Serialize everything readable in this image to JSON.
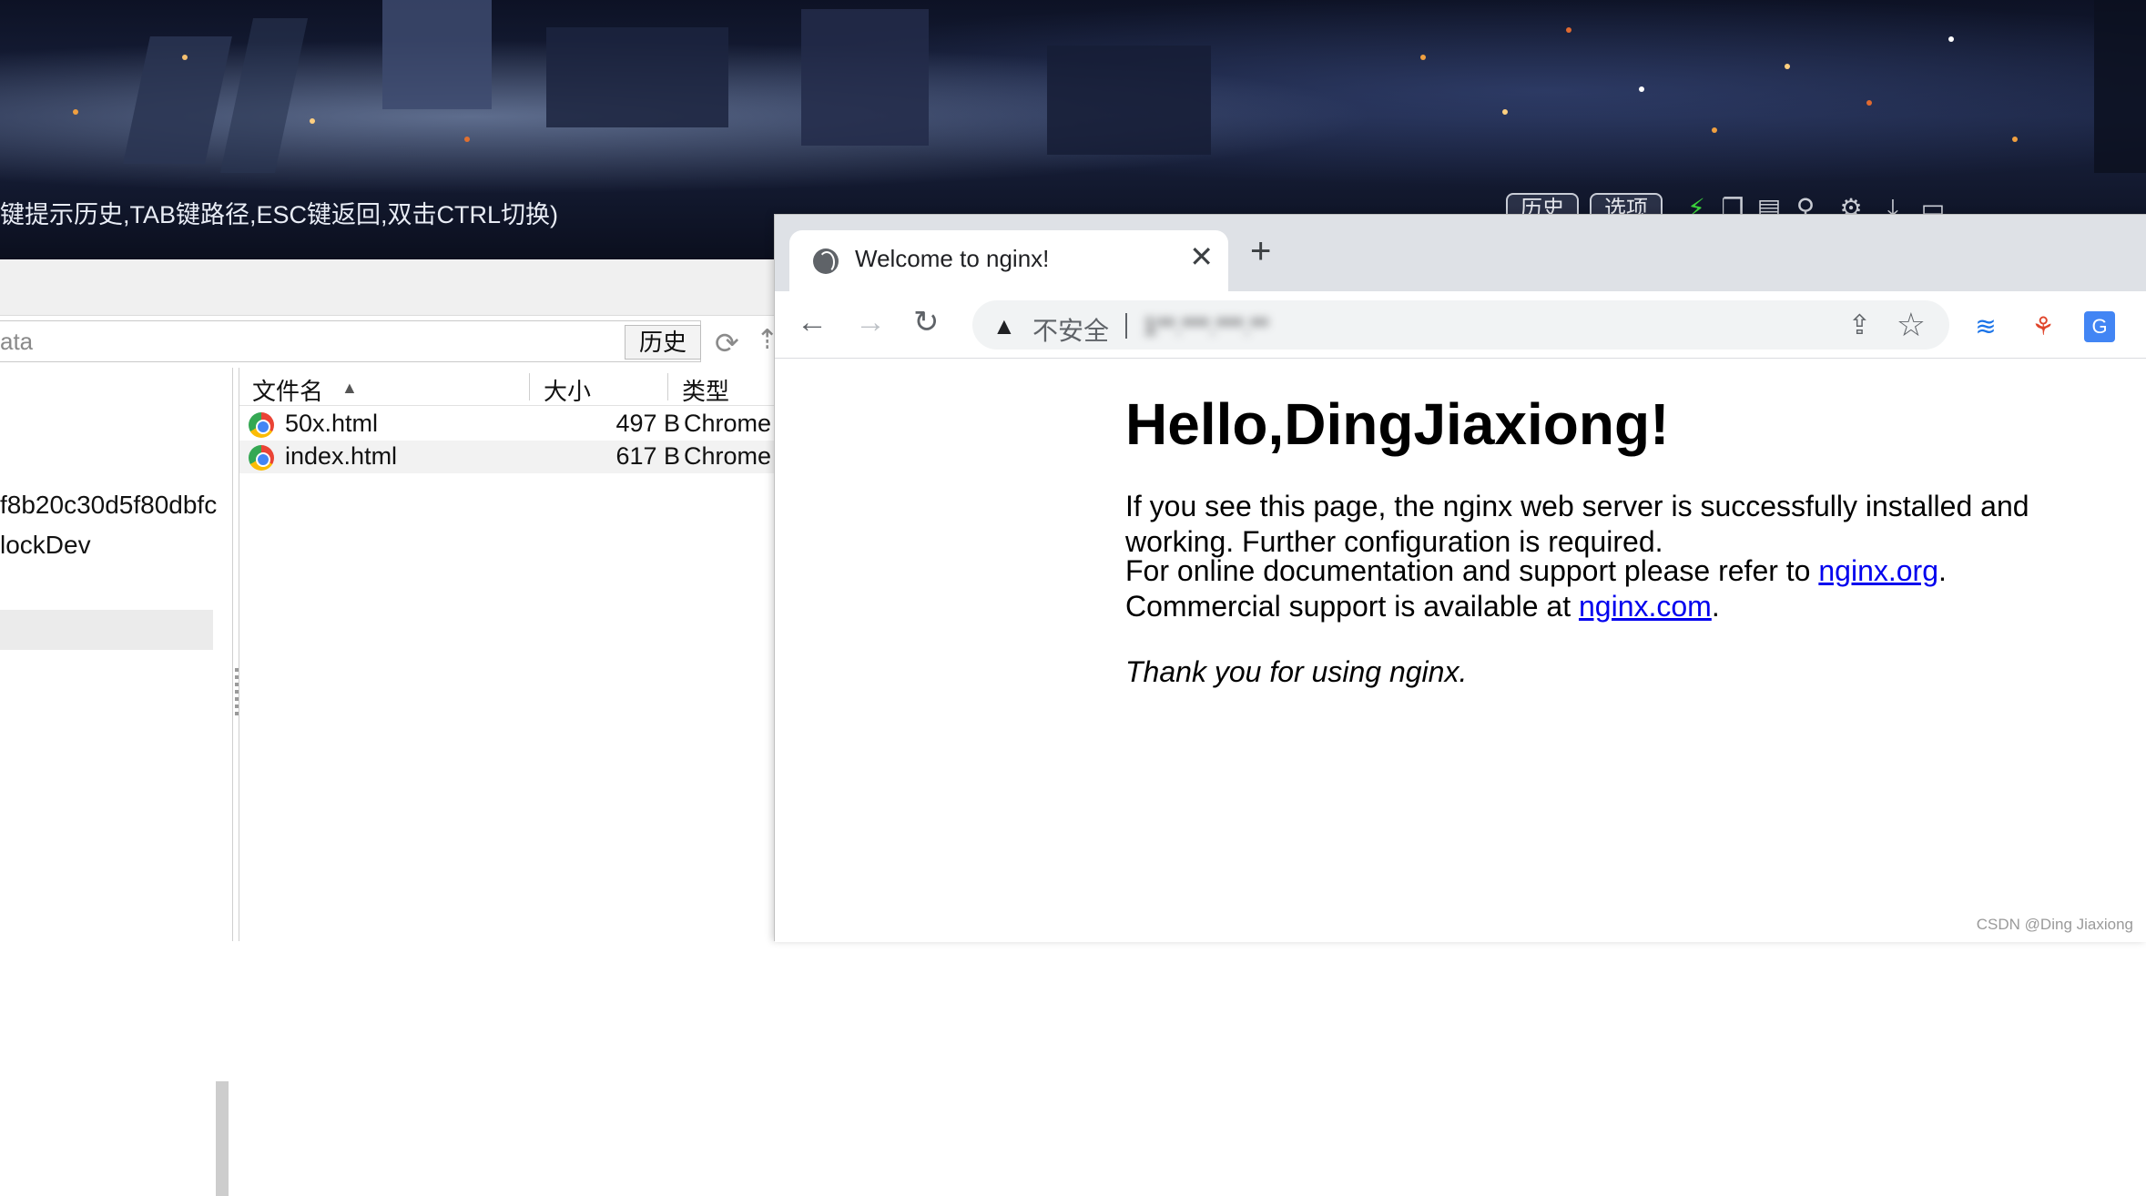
{
  "desktop": {
    "hint_text": "键提示历史,TAB键路径,ESC键返回,双击CTRL切换)",
    "history_pill": "历史",
    "options_pill": "选项"
  },
  "file_manager": {
    "path_value": "ata",
    "history_button": "历史",
    "tree_items": [
      "f8b20c30d5f80dbfc",
      "lockDev"
    ],
    "columns": {
      "name": "文件名",
      "size": "大小",
      "type": "类型"
    },
    "files": [
      {
        "name": "50x.html",
        "size": "497 B",
        "type": "Chrome"
      },
      {
        "name": "index.html",
        "size": "617 B",
        "type": "Chrome"
      }
    ]
  },
  "browser": {
    "tab_title": "Welcome to nginx!",
    "new_tab": "+",
    "omnibox": {
      "security_label": "不安全",
      "url": "1**.***.***.**"
    },
    "page": {
      "heading": "Hello,DingJiaxiong!",
      "para1": "If you see this page, the nginx web server is successfully installed and working. Further configuration is required.",
      "para2_prefix": "For online documentation and support please refer to ",
      "link_org": "nginx.org",
      "para2_mid": ".",
      "para2_line2_prefix": "Commercial support is available at ",
      "link_com": "nginx.com",
      "para2_end": ".",
      "para3": "Thank you for using nginx."
    }
  },
  "watermark": "CSDN @Ding Jiaxiong"
}
